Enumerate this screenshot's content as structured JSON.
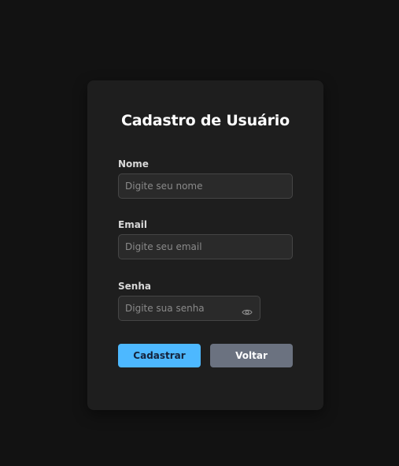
{
  "form": {
    "title": "Cadastro de Usuário",
    "name": {
      "label": "Nome",
      "placeholder": "Digite seu nome",
      "value": ""
    },
    "email": {
      "label": "Email",
      "placeholder": "Digite seu email",
      "value": ""
    },
    "password": {
      "label": "Senha",
      "placeholder": "Digite sua senha",
      "value": "",
      "icon": "eye-icon"
    },
    "submit_label": "Cadastrar",
    "back_label": "Voltar"
  },
  "colors": {
    "background": "#121212",
    "card": "#1e1e1e",
    "primary": "#4db8ff",
    "secondary": "#6b7280"
  }
}
